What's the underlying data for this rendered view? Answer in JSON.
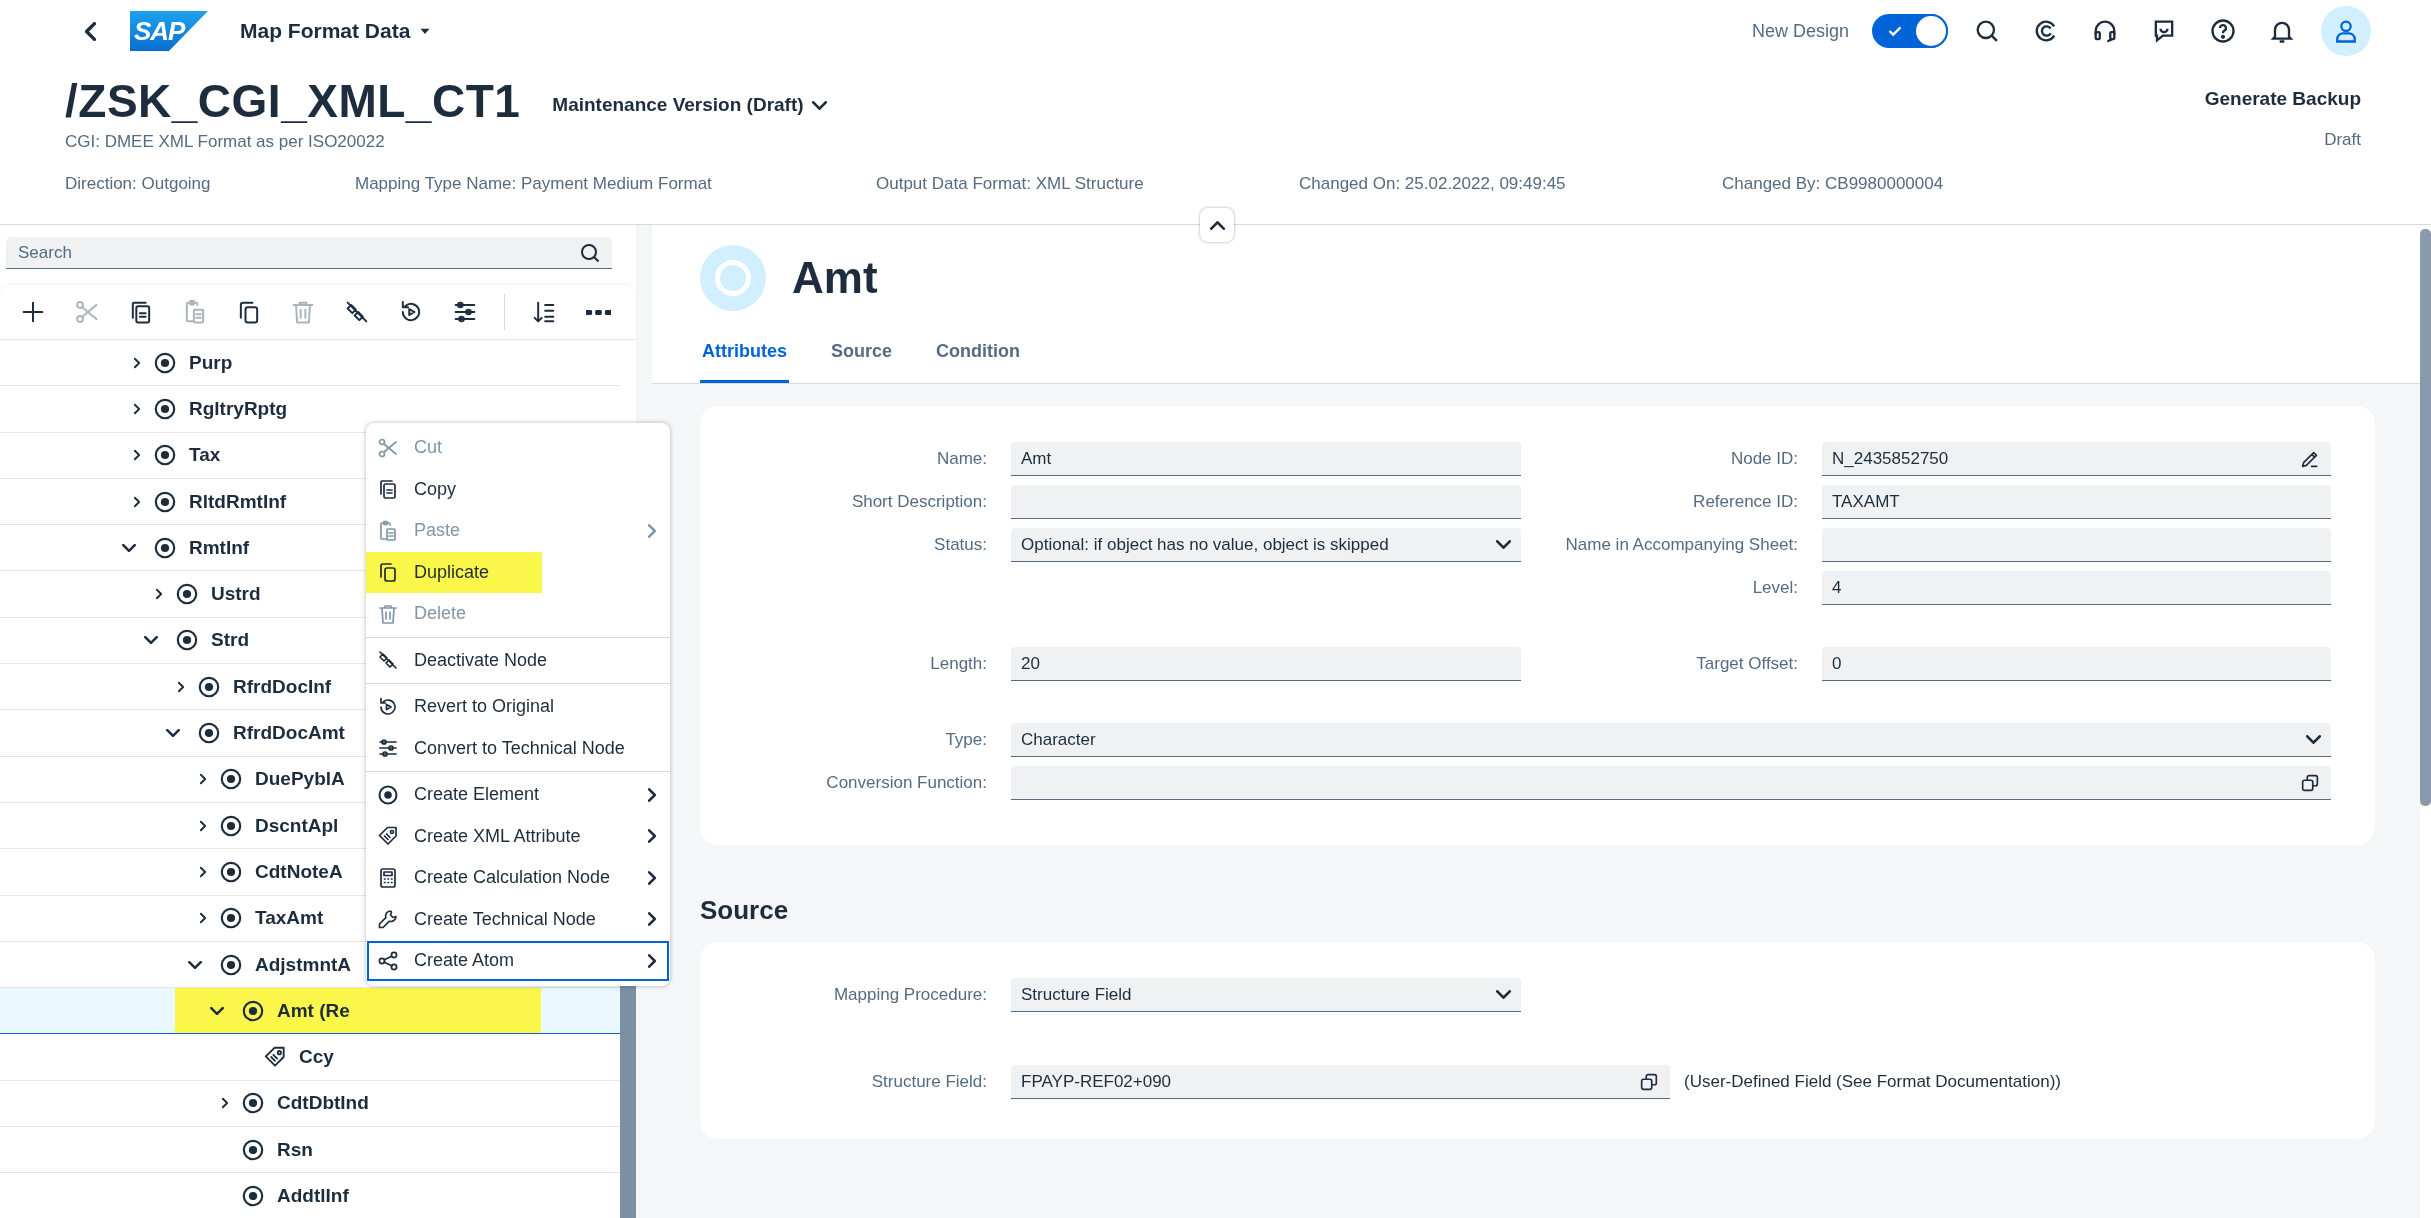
{
  "shell": {
    "logo": "SAP",
    "title": "Map Format Data",
    "new_design_label": "New Design",
    "new_design_on": true
  },
  "header": {
    "title": "/ZSK_CGI_XML_CT1",
    "version": "Maintenance Version (Draft)",
    "subtitle": "CGI: DMEE XML Format as per ISO20022",
    "attributes": [
      "Direction: Outgoing",
      "Mapping Type Name: Payment Medium Format",
      "Output Data Format: XML Structure",
      "Changed On: 25.02.2022, 09:49:45",
      "Changed By: CB9980000004"
    ],
    "action": "Generate Backup",
    "status": "Draft"
  },
  "tree_panel": {
    "search": {
      "placeholder": "Search"
    },
    "toolbar": [
      [
        {
          "kind": "add",
          "disabled": false
        },
        {
          "kind": "cut",
          "disabled": true
        },
        {
          "kind": "copy",
          "disabled": false
        },
        {
          "kind": "paste",
          "disabled": true
        },
        {
          "kind": "duplicate",
          "disabled": false
        },
        {
          "kind": "delete",
          "disabled": true
        },
        {
          "kind": "deactivate",
          "disabled": false
        },
        {
          "kind": "revert",
          "disabled": false
        },
        {
          "kind": "convert",
          "disabled": false
        }
      ],
      [
        {
          "kind": "sort",
          "disabled": false
        },
        {
          "kind": "more",
          "disabled": false
        }
      ]
    ],
    "tree": [
      {
        "name": "Purp",
        "kind": "element",
        "expandable": true,
        "expanded": false,
        "selected": false,
        "highlighted": false
      },
      {
        "name": "RgltryRptg",
        "kind": "element",
        "expandable": true,
        "expanded": false,
        "selected": false,
        "highlighted": false
      },
      {
        "name": "Tax",
        "kind": "element",
        "expandable": true,
        "expanded": false,
        "selected": false,
        "highlighted": false
      },
      {
        "name": "RltdRmtInf",
        "kind": "element",
        "expandable": true,
        "expanded": false,
        "selected": false,
        "highlighted": false
      },
      {
        "name": "RmtInf",
        "kind": "element",
        "expandable": true,
        "expanded": true,
        "selected": false,
        "highlighted": false,
        "children": [
          {
            "name": "Ustrd",
            "kind": "element",
            "expandable": true,
            "expanded": false,
            "selected": false,
            "highlighted": false
          },
          {
            "name": "Strd",
            "kind": "element",
            "expandable": true,
            "expanded": true,
            "selected": false,
            "highlighted": false,
            "children": [
              {
                "name": "RfrdDocInf",
                "kind": "element",
                "expandable": true,
                "expanded": false,
                "selected": false,
                "highlighted": false
              },
              {
                "name": "RfrdDocAmt",
                "kind": "element",
                "expandable": true,
                "expanded": true,
                "selected": false,
                "highlighted": false,
                "children": [
                  {
                    "name": "DuePyblA",
                    "kind": "element",
                    "expandable": true,
                    "expanded": false,
                    "selected": false,
                    "highlighted": false
                  },
                  {
                    "name": "DscntApl",
                    "kind": "element",
                    "expandable": true,
                    "expanded": false,
                    "selected": false,
                    "highlighted": false
                  },
                  {
                    "name": "CdtNoteA",
                    "kind": "element",
                    "expandable": true,
                    "expanded": false,
                    "selected": false,
                    "highlighted": false
                  },
                  {
                    "name": "TaxAmt",
                    "kind": "element",
                    "expandable": true,
                    "expanded": false,
                    "selected": false,
                    "highlighted": false
                  },
                  {
                    "name": "AdjstmntA",
                    "kind": "element",
                    "expandable": true,
                    "expanded": true,
                    "selected": false,
                    "highlighted": false,
                    "children": [
                      {
                        "name": "Amt (Re",
                        "kind": "element",
                        "expandable": true,
                        "expanded": true,
                        "selected": true,
                        "highlighted": true,
                        "children": [
                          {
                            "name": "Ccy",
                            "kind": "attribute",
                            "expandable": false,
                            "selected": false,
                            "highlighted": false
                          }
                        ]
                      },
                      {
                        "name": "CdtDbtInd",
                        "kind": "element",
                        "expandable": true,
                        "expanded": false,
                        "selected": false,
                        "highlighted": false
                      },
                      {
                        "name": "Rsn",
                        "kind": "element",
                        "expandable": false,
                        "selected": false,
                        "highlighted": false
                      },
                      {
                        "name": "AddtlInf",
                        "kind": "element",
                        "expandable": false,
                        "selected": false,
                        "highlighted": false
                      }
                    ]
                  }
                ]
              }
            ]
          }
        ]
      }
    ]
  },
  "context_menu": {
    "groups": [
      [
        {
          "label": "Cut",
          "kind": "cut",
          "disabled": true,
          "submenu": false,
          "highlighted": false,
          "focused": false
        },
        {
          "label": "Copy",
          "kind": "copy",
          "disabled": false,
          "submenu": false,
          "highlighted": false,
          "focused": false
        },
        {
          "label": "Paste",
          "kind": "paste",
          "disabled": true,
          "submenu": true,
          "highlighted": false,
          "focused": false
        },
        {
          "label": "Duplicate",
          "kind": "duplicate",
          "disabled": false,
          "submenu": false,
          "highlighted": true,
          "focused": false
        },
        {
          "label": "Delete",
          "kind": "delete",
          "disabled": true,
          "submenu": false,
          "highlighted": false,
          "focused": false
        }
      ],
      [
        {
          "label": "Deactivate Node",
          "kind": "deactivate",
          "disabled": false,
          "submenu": false,
          "highlighted": false,
          "focused": false
        }
      ],
      [
        {
          "label": "Revert to Original",
          "kind": "revert",
          "disabled": false,
          "submenu": false,
          "highlighted": false,
          "focused": false
        },
        {
          "label": "Convert to Technical Node",
          "kind": "convert",
          "disabled": false,
          "submenu": false,
          "highlighted": false,
          "focused": false
        }
      ],
      [
        {
          "label": "Create Element",
          "kind": "element",
          "disabled": false,
          "submenu": true,
          "highlighted": false,
          "focused": false
        },
        {
          "label": "Create XML Attribute",
          "kind": "attribute",
          "disabled": false,
          "submenu": true,
          "highlighted": false,
          "focused": false
        },
        {
          "label": "Create Calculation Node",
          "kind": "calculation",
          "disabled": false,
          "submenu": true,
          "highlighted": false,
          "focused": false
        },
        {
          "label": "Create Technical Node",
          "kind": "technical",
          "disabled": false,
          "submenu": true,
          "highlighted": false,
          "focused": false
        },
        {
          "label": "Create Atom",
          "kind": "atom",
          "disabled": false,
          "submenu": true,
          "highlighted": false,
          "focused": true
        }
      ]
    ]
  },
  "detail": {
    "title": "Amt",
    "tabs": [
      {
        "label": "Attributes",
        "selected": true
      },
      {
        "label": "Source",
        "selected": false
      },
      {
        "label": "Condition",
        "selected": false
      }
    ],
    "attributes": {
      "groups": [
        [
          {
            "left": {
              "label": "Name:",
              "value": "Amt",
              "kind": "text"
            },
            "right": {
              "label": "Node ID:",
              "value": "N_2435852750",
              "kind": "edit"
            }
          },
          {
            "left": {
              "label": "Short Description:",
              "kind": "text"
            },
            "right": {
              "label": "Reference ID:",
              "value": "TAXAMT",
              "kind": "text"
            }
          },
          {
            "left": {
              "label": "Status:",
              "value": "Optional: if object has no value, object is skipped",
              "kind": "select"
            },
            "right": {
              "label": "Name in Accompanying Sheet:",
              "kind": "text"
            }
          },
          {
            "right": {
              "label": "Level:",
              "value": "4",
              "kind": "text"
            }
          }
        ],
        [
          {
            "left": {
              "label": "Length:",
              "value": "20",
              "kind": "text"
            },
            "right": {
              "label": "Target Offset:",
              "value": "0",
              "kind": "text"
            }
          }
        ],
        [
          {
            "wide": {
              "label": "Type:",
              "value": "Character",
              "kind": "select"
            }
          },
          {
            "wide": {
              "label": "Conversion Function:",
              "kind": "valuehelp"
            }
          }
        ]
      ]
    },
    "source": {
      "title": "Source",
      "rows": [
        {
          "label": "Mapping Procedure:",
          "value": "Structure Field",
          "kind": "select"
        },
        {
          "label": "Structure Field:",
          "value": "FPAYP-REF02+090",
          "kind": "valuehelp",
          "note": "(User-Defined Field (See Format Documentation))"
        }
      ]
    }
  }
}
